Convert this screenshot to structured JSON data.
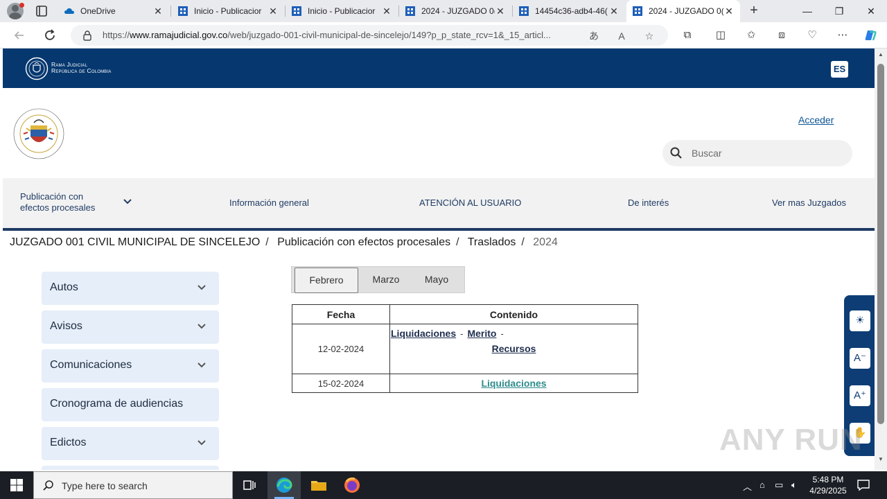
{
  "browser": {
    "tabs": [
      {
        "title": "OneDrive",
        "active": false
      },
      {
        "title": "Inicio - Publicacior",
        "active": false
      },
      {
        "title": "Inicio - Publicacior",
        "active": false
      },
      {
        "title": "2024 - JUZGADO 0(",
        "active": false
      },
      {
        "title": "14454c36-adb4-46(",
        "active": false
      },
      {
        "title": "2024 - JUZGADO 0(",
        "active": true
      }
    ],
    "url_prefix": "https://",
    "url_host": "www.ramajudicial.gov.co",
    "url_path": "/web/juzgado-001-civil-municipal-de-sincelejo/149?p_p_state_rcv=1&_15_articl..."
  },
  "site": {
    "brand_line1": "Rama Judicial",
    "brand_line2": "República de Colombia",
    "lang_label": "ES",
    "login_label": "Acceder",
    "search_placeholder": "Buscar"
  },
  "nav": {
    "item1_line1": "Publicación con",
    "item1_line2": "efectos procesales",
    "item2": "Información general",
    "item3": "ATENCIÓN AL USUARIO",
    "item4": "De interés",
    "item5": "Ver mas Juzgados"
  },
  "breadcrumb": {
    "b1": "JUZGADO 001 CIVIL MUNICIPAL DE SINCELEJO",
    "b2": "Publicación con efectos procesales",
    "b3": "Traslados",
    "b4": "2024",
    "sep": "/"
  },
  "sidebar": {
    "items": [
      "Autos",
      "Avisos",
      "Comunicaciones",
      "Cronograma de audiencias",
      "Edictos"
    ]
  },
  "months": {
    "m1": "Febrero",
    "m2": "Marzo",
    "m3": "Mayo"
  },
  "table": {
    "col1": "Fecha",
    "col2": "Contenido",
    "row1_date": "12-02-2024",
    "row1_link1": "Liquidaciones",
    "row1_link2": "Merito",
    "row1_link3": "Recursos",
    "row2_date": "15-02-2024",
    "row2_link1": "Liquidaciones",
    "dash": "-"
  },
  "watermark": "ANY RUN",
  "taskbar": {
    "search_placeholder": "Type here to search",
    "time": "5:48 PM",
    "date": "4/29/2025"
  },
  "colors": {
    "brand_navy": "#06386f",
    "link_teal": "#2e8b8b",
    "sidebar_bg": "#e6eef9"
  }
}
